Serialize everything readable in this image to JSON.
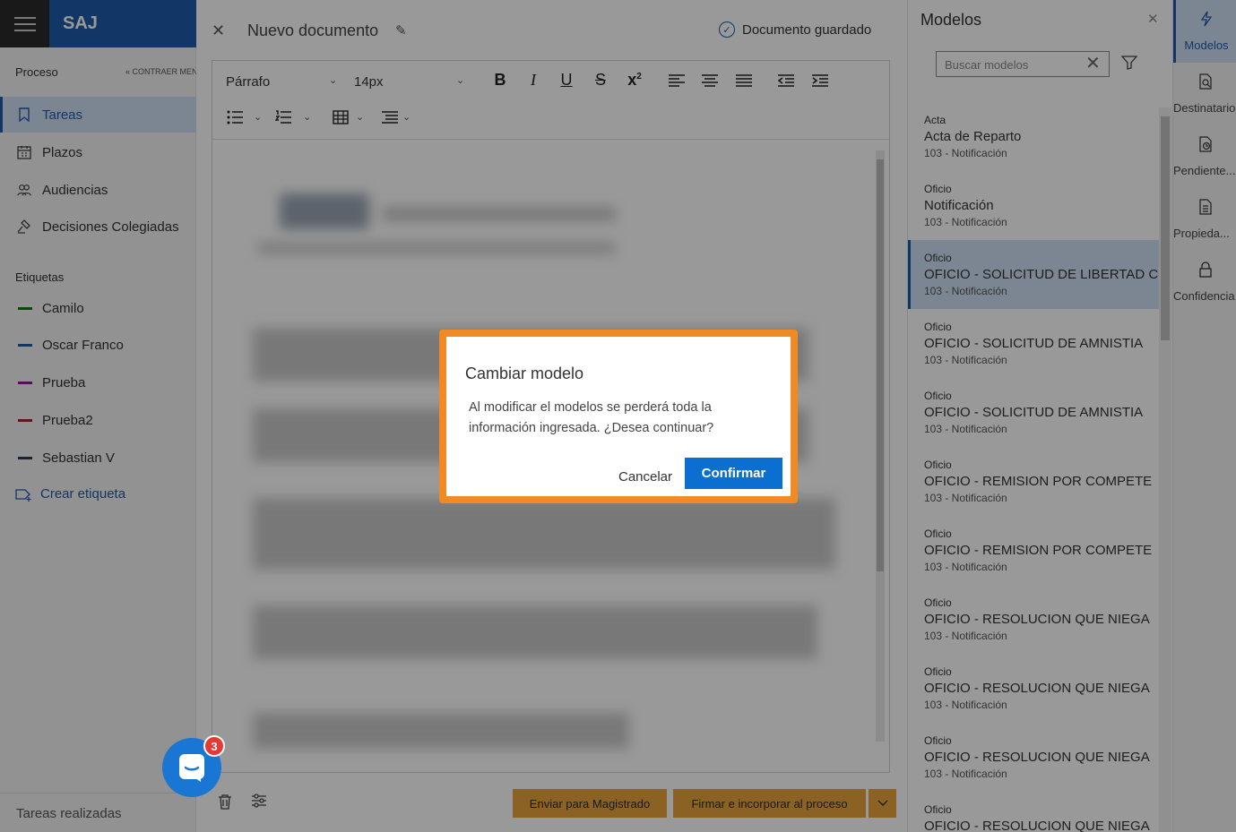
{
  "app": {
    "brand": "SAJ"
  },
  "sidebar": {
    "section_label": "Proceso",
    "collapse_label": "CONTRAER MENÚ",
    "items": [
      {
        "label": "Tareas",
        "icon": "bookmark-icon",
        "active": true
      },
      {
        "label": "Plazos",
        "icon": "calendar-icon",
        "active": false
      },
      {
        "label": "Audiencias",
        "icon": "people-icon",
        "active": false
      },
      {
        "label": "Decisiones Colegiadas",
        "icon": "gavel-icon",
        "active": false
      }
    ],
    "tags_label": "Etiquetas",
    "tags": [
      {
        "label": "Camilo",
        "color": "#107c10"
      },
      {
        "label": "Oscar Franco",
        "color": "#1e5aa8"
      },
      {
        "label": "Prueba",
        "color": "#8e1b8e"
      },
      {
        "label": "Prueba2",
        "color": "#a4262c"
      },
      {
        "label": "Sebastian V",
        "color": "#2b3a55"
      }
    ],
    "create_tag_label": "Crear etiqueta",
    "footer_label": "Tareas realizadas"
  },
  "editor": {
    "title": "Nuevo documento",
    "saved_status": "Documento guardado",
    "paragraph_style": "Párrafo",
    "font_size": "14px"
  },
  "actions": {
    "send_label": "Enviar para Magistrado",
    "sign_label": "Firmar e incorporar al proceso"
  },
  "models": {
    "title": "Modelos",
    "search_placeholder": "Buscar modelos",
    "items": [
      {
        "type": "Acta",
        "name": "Acta de Reparto",
        "sub": "103 - Notificación"
      },
      {
        "type": "Oficio",
        "name": "Notificación",
        "sub": "103 - Notificación"
      },
      {
        "type": "Oficio",
        "name": "OFICIO - SOLICITUD DE LIBERTAD C",
        "sub": "103 - Notificación",
        "selected": true
      },
      {
        "type": "Oficio",
        "name": "OFICIO - SOLICITUD DE AMNISTIA",
        "sub": "103 - Notificación"
      },
      {
        "type": "Oficio",
        "name": "OFICIO - SOLICITUD DE AMNISTIA",
        "sub": "103 - Notificación"
      },
      {
        "type": "Oficio",
        "name": "OFICIO - REMISION POR COMPETE",
        "sub": "103 - Notificación"
      },
      {
        "type": "Oficio",
        "name": "OFICIO - REMISION POR COMPETE",
        "sub": "103 - Notificación"
      },
      {
        "type": "Oficio",
        "name": "OFICIO - RESOLUCION QUE NIEGA",
        "sub": "103 - Notificación"
      },
      {
        "type": "Oficio",
        "name": "OFICIO - RESOLUCION QUE NIEGA",
        "sub": "103 - Notificación"
      },
      {
        "type": "Oficio",
        "name": "OFICIO - RESOLUCION QUE NIEGA",
        "sub": "103 - Notificación"
      },
      {
        "type": "Oficio",
        "name": "OFICIO - RESOLUCION QUE NIEGA",
        "sub": ""
      }
    ]
  },
  "rail": {
    "items": [
      {
        "label": "Modelos",
        "icon": "lightning-icon",
        "active": true
      },
      {
        "label": "Destinatarios",
        "icon": "document-search-icon"
      },
      {
        "label": "Pendientes",
        "icon": "document-clock-icon"
      },
      {
        "label": "Propiedades",
        "icon": "document-icon"
      },
      {
        "label": "Confidencial",
        "icon": "lock-icon"
      }
    ],
    "display": [
      "Modelos",
      "Destinatario",
      "Pendiente...",
      "Propieda...",
      "Confidencia"
    ]
  },
  "dialog": {
    "title": "Cambiar modelo",
    "message": "Al modificar el modelos se perderá toda la información ingresada. ¿Desea continuar?",
    "cancel_label": "Cancelar",
    "confirm_label": "Confirmar"
  },
  "chat": {
    "badge_count": "3"
  },
  "colors": {
    "accent": "#1e5aa8",
    "confirm": "#0a6fd0",
    "highlight": "#f08a24",
    "action": "#e8a33b"
  }
}
